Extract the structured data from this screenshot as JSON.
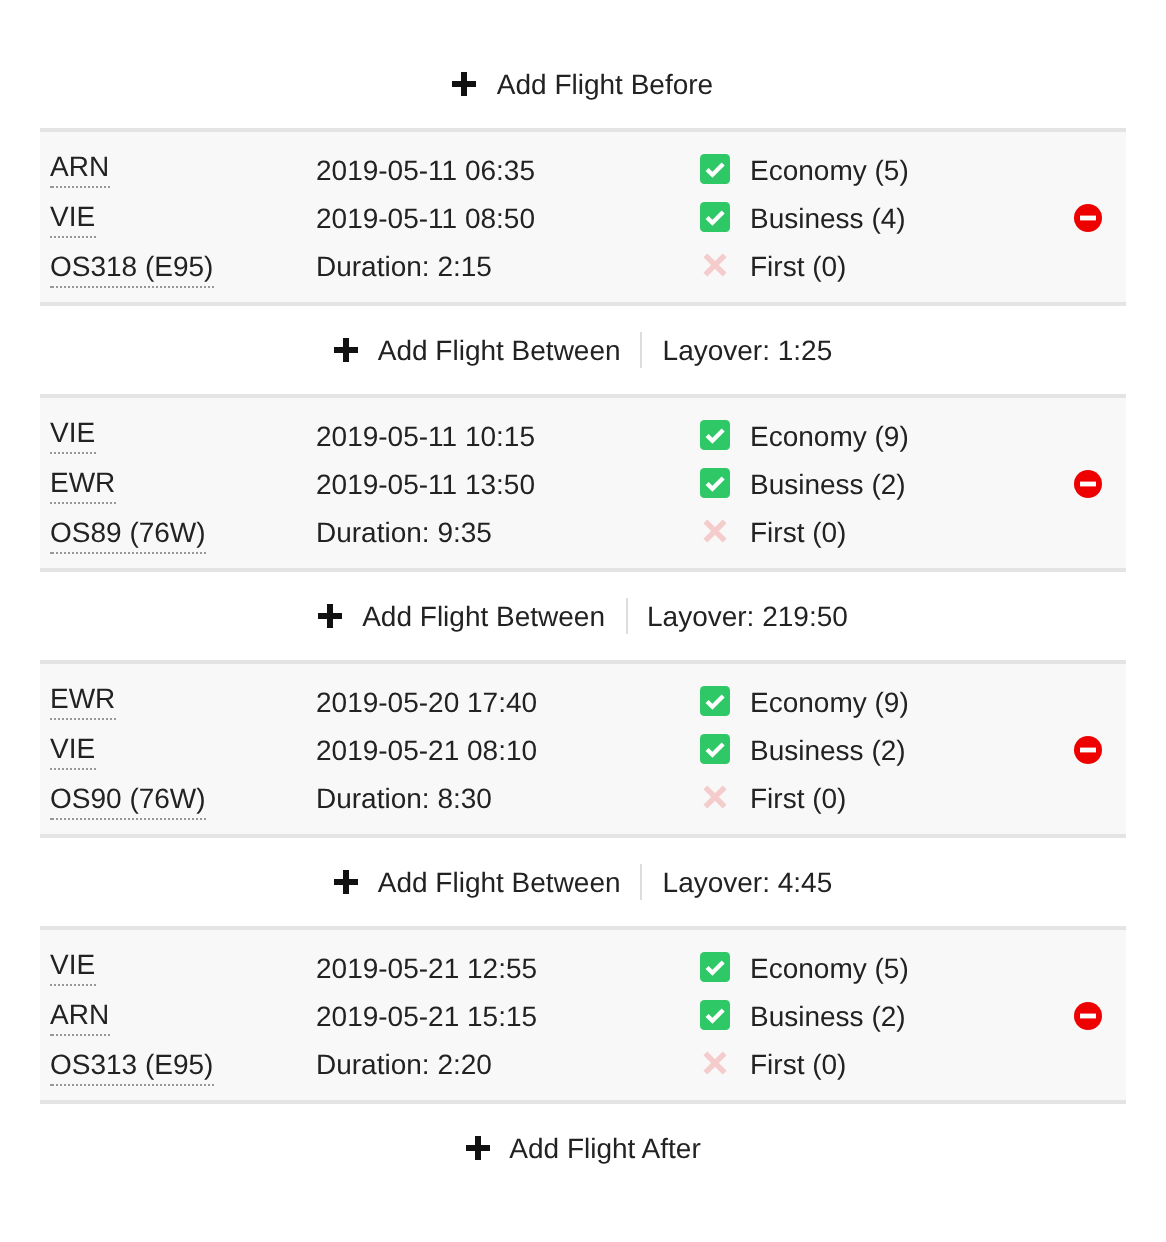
{
  "add_before": {
    "label": "Add Flight Before"
  },
  "flights": [
    {
      "from": "ARN",
      "to": "VIE",
      "flight": "OS318 (E95)",
      "departure": "2019-05-11 06:35",
      "arrival": "2019-05-11 08:50",
      "duration": "Duration: 2:15",
      "classes": [
        {
          "label": "Economy (5)",
          "checked": true
        },
        {
          "label": "Business (4)",
          "checked": true
        },
        {
          "label": "First (0)",
          "checked": false
        }
      ]
    },
    {
      "from": "VIE",
      "to": "EWR",
      "flight": "OS89 (76W)",
      "departure": "2019-05-11 10:15",
      "arrival": "2019-05-11 13:50",
      "duration": "Duration: 9:35",
      "classes": [
        {
          "label": "Economy (9)",
          "checked": true
        },
        {
          "label": "Business (2)",
          "checked": true
        },
        {
          "label": "First (0)",
          "checked": false
        }
      ]
    },
    {
      "from": "EWR",
      "to": "VIE",
      "flight": "OS90 (76W)",
      "departure": "2019-05-20 17:40",
      "arrival": "2019-05-21 08:10",
      "duration": "Duration: 8:30",
      "classes": [
        {
          "label": "Economy (9)",
          "checked": true
        },
        {
          "label": "Business (2)",
          "checked": true
        },
        {
          "label": "First (0)",
          "checked": false
        }
      ]
    },
    {
      "from": "VIE",
      "to": "ARN",
      "flight": "OS313 (E95)",
      "departure": "2019-05-21 12:55",
      "arrival": "2019-05-21 15:15",
      "duration": "Duration: 2:20",
      "classes": [
        {
          "label": "Economy (5)",
          "checked": true
        },
        {
          "label": "Business (2)",
          "checked": true
        },
        {
          "label": "First (0)",
          "checked": false
        }
      ]
    }
  ],
  "connections": [
    {
      "label": "Add Flight Between",
      "layover": "Layover: 1:25"
    },
    {
      "label": "Add Flight Between",
      "layover": "Layover: 219:50"
    },
    {
      "label": "Add Flight Between",
      "layover": "Layover: 4:45"
    }
  ],
  "add_after": {
    "label": "Add Flight After"
  }
}
